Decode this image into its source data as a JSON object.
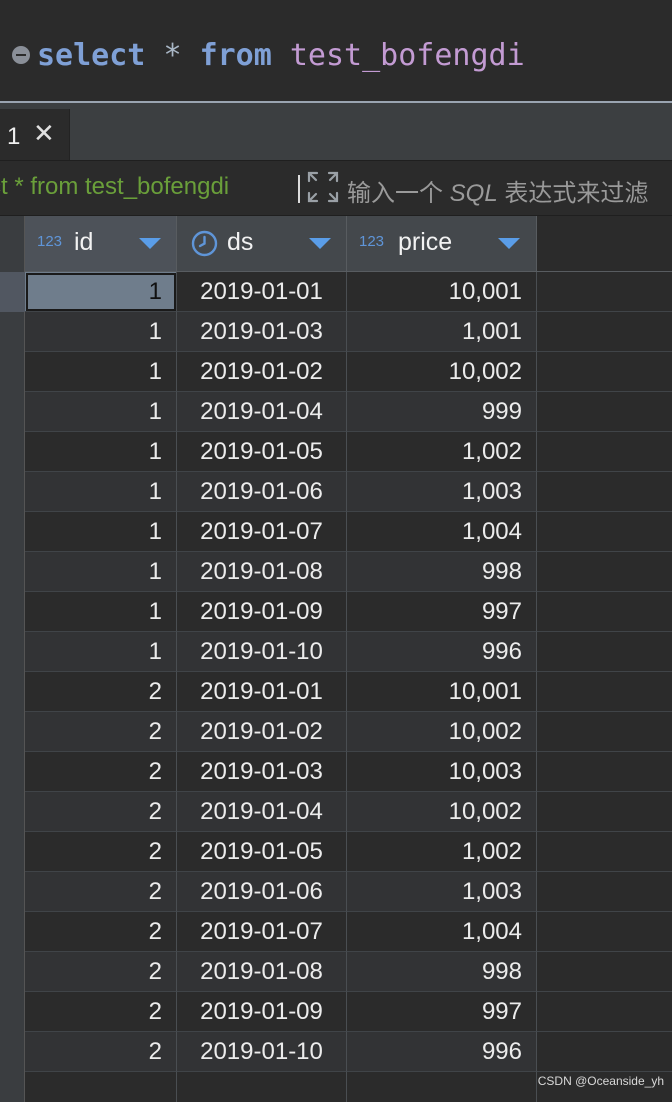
{
  "editor": {
    "kw_select": "select",
    "star": "*",
    "kw_from": "from",
    "table": "test_bofengdi"
  },
  "tabs": [
    {
      "label": "1"
    }
  ],
  "filter": {
    "query": "ct * from test_bofengdi",
    "placeholder_pre": "输入一个 ",
    "placeholder_sql": "SQL",
    "placeholder_post": " 表达式来过滤"
  },
  "columns": [
    {
      "badge": "123",
      "label": "id",
      "icon": "numeric-type-icon"
    },
    {
      "badge": "",
      "label": "ds",
      "icon": "clock-icon"
    },
    {
      "badge": "123",
      "label": "price",
      "icon": "numeric-type-icon"
    }
  ],
  "rows": [
    {
      "id": "1",
      "ds": "2019-01-01",
      "price": "10,001"
    },
    {
      "id": "1",
      "ds": "2019-01-03",
      "price": "1,001"
    },
    {
      "id": "1",
      "ds": "2019-01-02",
      "price": "10,002"
    },
    {
      "id": "1",
      "ds": "2019-01-04",
      "price": "999"
    },
    {
      "id": "1",
      "ds": "2019-01-05",
      "price": "1,002"
    },
    {
      "id": "1",
      "ds": "2019-01-06",
      "price": "1,003"
    },
    {
      "id": "1",
      "ds": "2019-01-07",
      "price": "1,004"
    },
    {
      "id": "1",
      "ds": "2019-01-08",
      "price": "998"
    },
    {
      "id": "1",
      "ds": "2019-01-09",
      "price": "997"
    },
    {
      "id": "1",
      "ds": "2019-01-10",
      "price": "996"
    },
    {
      "id": "2",
      "ds": "2019-01-01",
      "price": "10,001"
    },
    {
      "id": "2",
      "ds": "2019-01-02",
      "price": "10,002"
    },
    {
      "id": "2",
      "ds": "2019-01-03",
      "price": "10,003"
    },
    {
      "id": "2",
      "ds": "2019-01-04",
      "price": "10,002"
    },
    {
      "id": "2",
      "ds": "2019-01-05",
      "price": "1,002"
    },
    {
      "id": "2",
      "ds": "2019-01-06",
      "price": "1,003"
    },
    {
      "id": "2",
      "ds": "2019-01-07",
      "price": "1,004"
    },
    {
      "id": "2",
      "ds": "2019-01-08",
      "price": "998"
    },
    {
      "id": "2",
      "ds": "2019-01-09",
      "price": "997"
    },
    {
      "id": "2",
      "ds": "2019-01-10",
      "price": "996"
    }
  ],
  "watermark": "CSDN @Oceanside_yh",
  "colors": {
    "keyword": "#7fa0d6",
    "table_name": "#c39bd3",
    "filter_query": "#6a9f3a",
    "sort_arrow": "#5a9de8",
    "type_badge": "#5f95d8"
  }
}
